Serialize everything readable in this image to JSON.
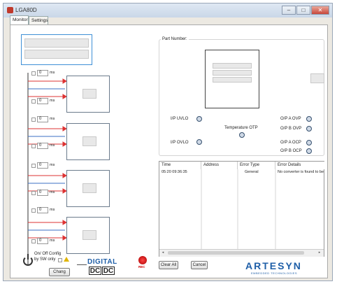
{
  "window": {
    "title": "LGA80D",
    "controls": {
      "minimize": "–",
      "maximize": "□",
      "close": "✕"
    }
  },
  "tabs": [
    {
      "label": "Monitor",
      "active": true
    },
    {
      "label": "Settings",
      "active": false
    }
  ],
  "sequencer": {
    "delays": [
      {
        "value": "0",
        "unit": "ms"
      },
      {
        "value": "0",
        "unit": "ms"
      },
      {
        "value": "0",
        "unit": "ms"
      },
      {
        "value": "0",
        "unit": "ms"
      },
      {
        "value": "0",
        "unit": "ms"
      },
      {
        "value": "0",
        "unit": "ms"
      },
      {
        "value": "0",
        "unit": "ms"
      },
      {
        "value": "0",
        "unit": "ms"
      }
    ]
  },
  "part_number": {
    "label": "Part Number:"
  },
  "faults": {
    "ip_uvlo": "I/P UVLO",
    "ip_ovlo": "I/P OVLO",
    "temperature_otp": "Temperature OTP",
    "opa_ovp": "O/P A OVP",
    "opb_ovp": "O/P B OVP",
    "opa_ocp": "O/P A OCP",
    "opb_ocp": "O/P B OCP"
  },
  "error_log": {
    "columns": [
      "Time",
      "Address",
      "Error Type",
      "Error Details"
    ],
    "rows": [
      {
        "time": "05:20 09:36:35",
        "address": "",
        "type": "General",
        "details": "No converter is found to be"
      }
    ]
  },
  "onoff": {
    "label_line1": "On/ Off Config",
    "label_line2": "by SW only",
    "change_button": "Chang"
  },
  "buttons": {
    "clear_all": "Clear All",
    "cancel": "Cancel"
  },
  "brand": {
    "digital": "DIGITAL",
    "dc1": "DC",
    "dc2": "DC",
    "rec": "REC",
    "artesyn": "ARTESYN",
    "artesyn_sub": "EMBEDDED TECHNOLOGIES",
    "accent_red": "#d71920",
    "accent_blue": "#1f5fa8"
  }
}
